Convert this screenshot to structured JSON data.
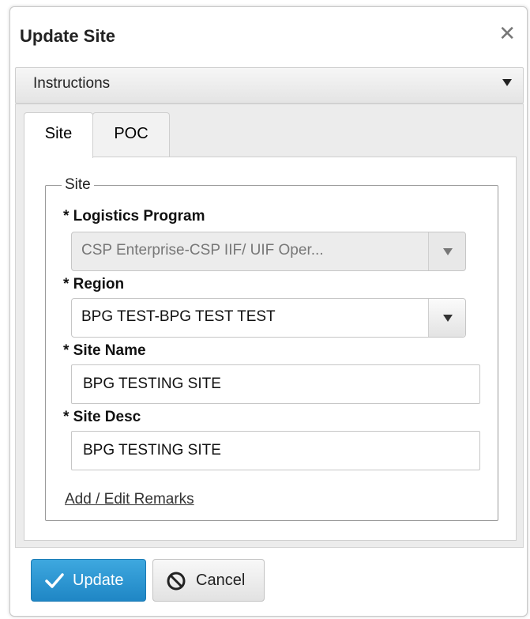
{
  "dialog": {
    "title": "Update Site",
    "close_glyph": "✕"
  },
  "instructions": {
    "label": "Instructions"
  },
  "tabs": [
    {
      "label": "Site",
      "active": true
    },
    {
      "label": "POC",
      "active": false
    }
  ],
  "site_group": {
    "legend": "Site",
    "logistics_program": {
      "label": "* Logistics Program",
      "value": "CSP Enterprise-CSP IIF/ UIF Oper...",
      "disabled": true
    },
    "region": {
      "label": "* Region",
      "value": "BPG TEST-BPG TEST TEST"
    },
    "site_name": {
      "label": "* Site Name",
      "value": "BPG TESTING SITE"
    },
    "site_desc": {
      "label": "* Site Desc",
      "value": "BPG TESTING SITE"
    },
    "remarks_link": "Add / Edit Remarks"
  },
  "buttons": {
    "update": "Update",
    "cancel": "Cancel"
  },
  "colors": {
    "primary": "#2a93d5",
    "panel_bg": "#ececec"
  }
}
